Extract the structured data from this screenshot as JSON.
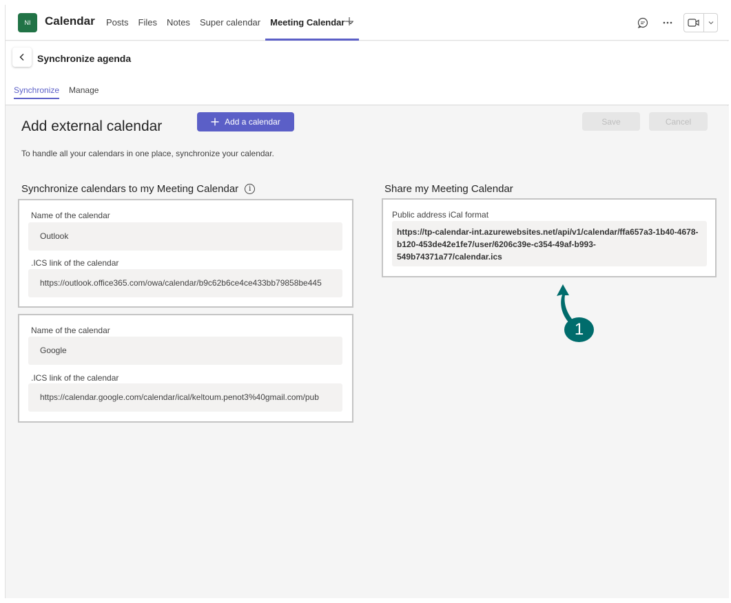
{
  "header": {
    "avatar_initials": "NI",
    "app_title": "Calendar",
    "tabs": [
      {
        "label": "Posts"
      },
      {
        "label": "Files"
      },
      {
        "label": "Notes"
      },
      {
        "label": "Super calendar"
      },
      {
        "label": "Meeting Calendar",
        "active": true
      }
    ],
    "icons": [
      "chat-icon",
      "more-icon",
      "video-call-icon",
      "chevron-down-icon"
    ]
  },
  "subheader": {
    "title": "Synchronize agenda",
    "tabs": [
      {
        "label": "Synchronize",
        "active": true
      },
      {
        "label": "Manage"
      }
    ]
  },
  "main": {
    "page_title": "Add external calendar",
    "add_button": "Add a calendar",
    "save_button": "Save",
    "cancel_button": "Cancel",
    "description": "To handle all your calendars in one place, synchronize your calendar.",
    "sync_section": {
      "title": "Synchronize calendars to my Meeting Calendar",
      "calendars": [
        {
          "name_label": "Name of the calendar",
          "name_value": "Outlook",
          "link_label": ".ICS link of the calendar",
          "link_value": "https://outlook.office365.com/owa/calendar/b9c62b6ce4ce433bb79858be445"
        },
        {
          "name_label": "Name of the calendar",
          "name_value": "Google",
          "link_label": ".ICS link of the calendar",
          "link_value": "https://calendar.google.com/calendar/ical/keltoum.penot3%40gmail.com/pub"
        }
      ]
    },
    "share_section": {
      "title": "Share my Meeting Calendar",
      "ical_label": "Public address iCal format",
      "ical_lines": [
        "https://tp-calendar-int.azurewebsites.net/api/v1/calendar/ffa657a3-1b40-4678-",
        "b120-453de42e1fe7/user/6206c39e-c354-49af-b993-",
        "549b74371a77/calendar.ics"
      ]
    },
    "callout_number": "1"
  },
  "colors": {
    "accent": "#5b5fc7",
    "avatar": "#217346",
    "callout": "#006c6c"
  }
}
